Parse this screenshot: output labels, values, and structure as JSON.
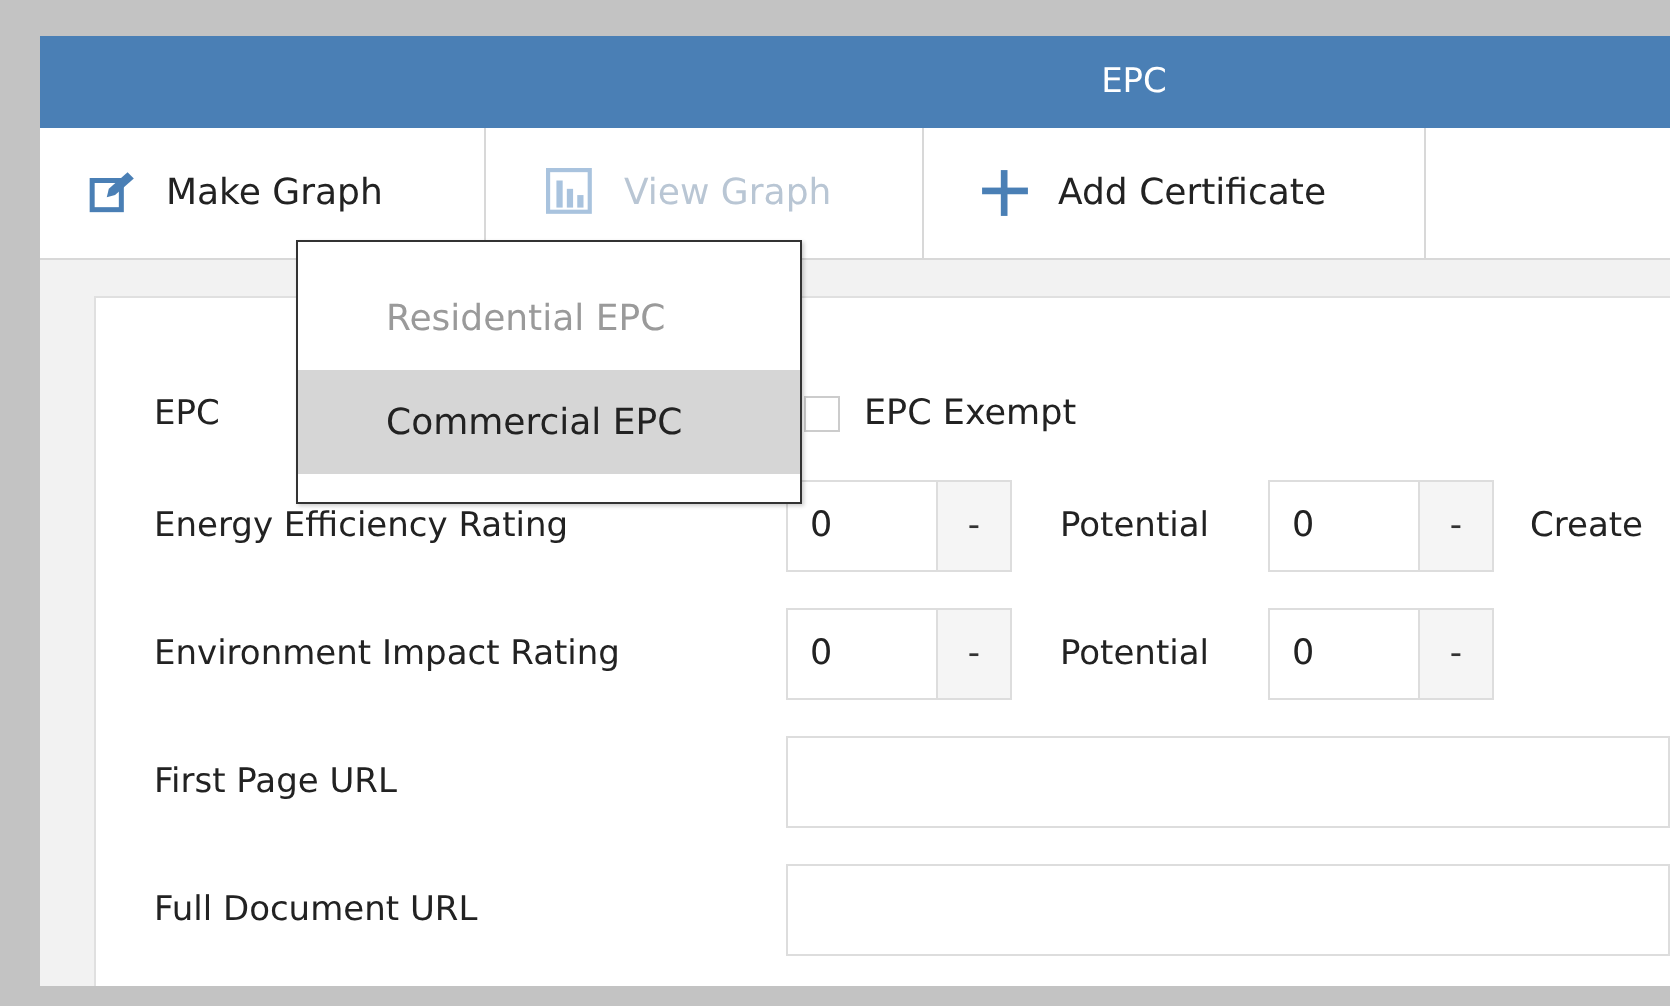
{
  "window": {
    "title": "EPC"
  },
  "toolbar": [
    {
      "label": "Make Graph",
      "kind": "edit",
      "disabled": false
    },
    {
      "label": "View Graph",
      "kind": "chart",
      "disabled": true
    },
    {
      "label": "Add Certificate",
      "kind": "plus",
      "disabled": false
    }
  ],
  "menu": {
    "items": [
      {
        "label": "Residential EPC",
        "disabled": true,
        "selected": false
      },
      {
        "label": "Commercial EPC",
        "disabled": false,
        "selected": true
      }
    ]
  },
  "form": {
    "rows": [
      {
        "kind": "type",
        "label": "EPC",
        "checkbox": {
          "label": "EPC Exempt",
          "checked": false
        }
      },
      {
        "kind": "rating",
        "label": "Energy Efficiency Rating",
        "value": "0",
        "button": "-",
        "potential_label": "Potential",
        "potential_value": "0",
        "potential_button": "-",
        "extra": "Create"
      },
      {
        "kind": "rating",
        "label": "Environment Impact Rating",
        "value": "0",
        "button": "-",
        "potential_label": "Potential",
        "potential_value": "0",
        "potential_button": "-"
      },
      {
        "kind": "url",
        "label": "First Page URL"
      },
      {
        "kind": "url",
        "label": "Full Document URL"
      }
    ]
  }
}
